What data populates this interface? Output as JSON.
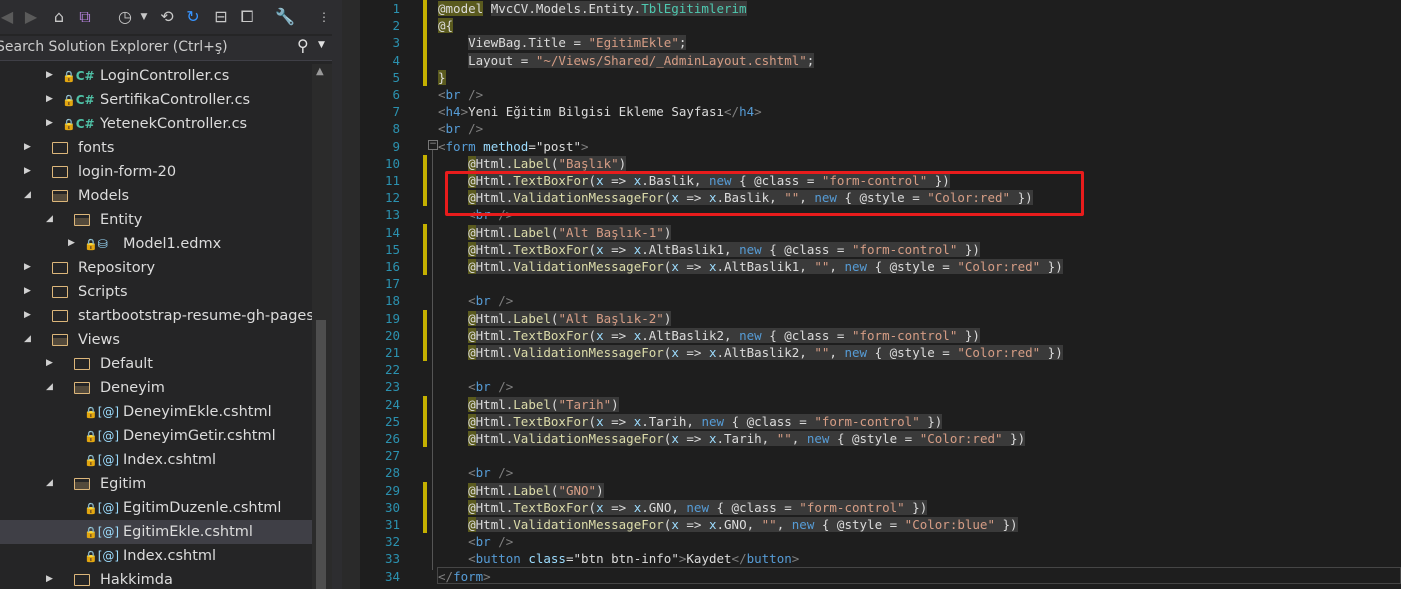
{
  "solution_explorer": {
    "search_placeholder": "Search Solution Explorer (Ctrl+ş)",
    "tree": [
      {
        "label": "LoginController.cs",
        "type": "cs",
        "level": 2,
        "expander": "collapsed"
      },
      {
        "label": "SertifikaController.cs",
        "type": "cs",
        "level": 2,
        "expander": "collapsed"
      },
      {
        "label": "YetenekController.cs",
        "type": "cs",
        "level": 2,
        "expander": "collapsed"
      },
      {
        "label": "fonts",
        "type": "folder",
        "level": 1,
        "expander": "collapsed"
      },
      {
        "label": "login-form-20",
        "type": "folder",
        "level": 1,
        "expander": "collapsed"
      },
      {
        "label": "Models",
        "type": "folder-open",
        "level": 1,
        "expander": "expanded"
      },
      {
        "label": "Entity",
        "type": "folder-open",
        "level": 2,
        "expander": "expanded"
      },
      {
        "label": "Model1.edmx",
        "type": "edmx",
        "level": 3,
        "expander": "collapsed"
      },
      {
        "label": "Repository",
        "type": "folder",
        "level": 1,
        "expander": "collapsed"
      },
      {
        "label": "Scripts",
        "type": "folder",
        "level": 1,
        "expander": "collapsed"
      },
      {
        "label": "startbootstrap-resume-gh-pages",
        "type": "folder",
        "level": 1,
        "expander": "collapsed"
      },
      {
        "label": "Views",
        "type": "folder-open",
        "level": 1,
        "expander": "expanded"
      },
      {
        "label": "Default",
        "type": "folder",
        "level": 2,
        "expander": "collapsed"
      },
      {
        "label": "Deneyim",
        "type": "folder-open",
        "level": 2,
        "expander": "expanded"
      },
      {
        "label": "DeneyimEkle.cshtml",
        "type": "razor",
        "level": 3,
        "expander": "none"
      },
      {
        "label": "DeneyimGetir.cshtml",
        "type": "razor",
        "level": 3,
        "expander": "none"
      },
      {
        "label": "Index.cshtml",
        "type": "razor",
        "level": 3,
        "expander": "none"
      },
      {
        "label": "Egitim",
        "type": "folder-open",
        "level": 2,
        "expander": "expanded"
      },
      {
        "label": "EgitimDuzenle.cshtml",
        "type": "razor",
        "level": 3,
        "expander": "none"
      },
      {
        "label": "EgitimEkle.cshtml",
        "type": "razor",
        "level": 3,
        "expander": "none",
        "selected": true
      },
      {
        "label": "Index.cshtml",
        "type": "razor",
        "level": 3,
        "expander": "none"
      },
      {
        "label": "Hakkimda",
        "type": "folder",
        "level": 2,
        "expander": "collapsed"
      }
    ]
  },
  "editor": {
    "lines": [
      {
        "n": "1",
        "changed": true,
        "html": "<span class=\"rz2\">@model</span> <span class=\"hl\">MvcCV.Models.Entity.<span class=\"ty\">TblEgitimlerim</span></span>"
      },
      {
        "n": "2",
        "changed": true,
        "html": "<span class=\"rz2\">@{</span>"
      },
      {
        "n": "3",
        "changed": true,
        "html": "    <span class=\"hl\">ViewBag.Title = <span class=\"s\">\"EgitimEkle\"</span>;</span>"
      },
      {
        "n": "4",
        "changed": true,
        "html": "    <span class=\"hl\">Layout = <span class=\"s\">\"~/Views/Shared/_AdminLayout.cshtml\"</span>;</span>"
      },
      {
        "n": "5",
        "changed": true,
        "html": "<span class=\"rz2\">}</span>"
      },
      {
        "n": "6",
        "changed": false,
        "html": "<span class=\"tg\">&lt;</span><span class=\"t\">br</span> <span class=\"tg\">/&gt;</span>"
      },
      {
        "n": "7",
        "changed": false,
        "html": "<span class=\"tg\">&lt;</span><span class=\"t\">h4</span><span class=\"tg\">&gt;</span>Yeni Eğitim Bilgisi Ekleme Sayfası<span class=\"tg\">&lt;/</span><span class=\"t\">h4</span><span class=\"tg\">&gt;</span>"
      },
      {
        "n": "8",
        "changed": false,
        "html": "<span class=\"tg\">&lt;</span><span class=\"t\">br</span> <span class=\"tg\">/&gt;</span>"
      },
      {
        "n": "9",
        "changed": false,
        "html": "<span class=\"tg\">&lt;</span><span class=\"t\">form</span> <span class=\"at\">method</span>=\"post\"<span class=\"tg\">&gt;</span>"
      },
      {
        "n": "10",
        "changed": true,
        "html": "    <span class=\"hl\"><span class=\"rz2\">@</span>Html.<span class=\"m\">Label</span>(<span class=\"s\">\"Başlık\"</span>)</span>"
      },
      {
        "n": "11",
        "changed": true,
        "html": "    <span class=\"hl\"><span class=\"rz2\">@</span>Html.<span class=\"m\">TextBoxFor</span>(<span class=\"at\">x</span> =&gt; <span class=\"at\">x</span>.Baslik, <span class=\"k\">new</span> { @class = <span class=\"s\">\"form-control\"</span> })</span>"
      },
      {
        "n": "12",
        "changed": true,
        "html": "    <span class=\"hl\"><span class=\"rz2\">@</span>Html.<span class=\"m\">ValidationMessageFor</span>(<span class=\"at\">x</span> =&gt; <span class=\"at\">x</span>.Baslik, <span class=\"s\">\"\"</span>, <span class=\"k\">new</span> { @style = <span class=\"s\">\"Color:red\"</span> })</span>"
      },
      {
        "n": "13",
        "changed": false,
        "html": "    <span class=\"tg\">&lt;</span><span class=\"t\">br</span> <span class=\"tg\">/&gt;</span>"
      },
      {
        "n": "14",
        "changed": true,
        "html": "    <span class=\"hl\"><span class=\"rz2\">@</span>Html.<span class=\"m\">Label</span>(<span class=\"s\">\"Alt Başlık-1\"</span>)</span>"
      },
      {
        "n": "15",
        "changed": true,
        "html": "    <span class=\"hl\"><span class=\"rz2\">@</span>Html.<span class=\"m\">TextBoxFor</span>(<span class=\"at\">x</span> =&gt; <span class=\"at\">x</span>.AltBaslik1, <span class=\"k\">new</span> { @class = <span class=\"s\">\"form-control\"</span> })</span>"
      },
      {
        "n": "16",
        "changed": true,
        "html": "    <span class=\"hl\"><span class=\"rz2\">@</span>Html.<span class=\"m\">ValidationMessageFor</span>(<span class=\"at\">x</span> =&gt; <span class=\"at\">x</span>.AltBaslik1, <span class=\"s\">\"\"</span>, <span class=\"k\">new</span> { @style = <span class=\"s\">\"Color:red\"</span> })</span>"
      },
      {
        "n": "17",
        "changed": false,
        "html": ""
      },
      {
        "n": "18",
        "changed": false,
        "html": "    <span class=\"tg\">&lt;</span><span class=\"t\">br</span> <span class=\"tg\">/&gt;</span>"
      },
      {
        "n": "19",
        "changed": true,
        "html": "    <span class=\"hl\"><span class=\"rz2\">@</span>Html.<span class=\"m\">Label</span>(<span class=\"s\">\"Alt Başlık-2\"</span>)</span>"
      },
      {
        "n": "20",
        "changed": true,
        "html": "    <span class=\"hl\"><span class=\"rz2\">@</span>Html.<span class=\"m\">TextBoxFor</span>(<span class=\"at\">x</span> =&gt; <span class=\"at\">x</span>.AltBaslik2, <span class=\"k\">new</span> { @class = <span class=\"s\">\"form-control\"</span> })</span>"
      },
      {
        "n": "21",
        "changed": true,
        "html": "    <span class=\"hl\"><span class=\"rz2\">@</span>Html.<span class=\"m\">ValidationMessageFor</span>(<span class=\"at\">x</span> =&gt; <span class=\"at\">x</span>.AltBaslik2, <span class=\"s\">\"\"</span>, <span class=\"k\">new</span> { @style = <span class=\"s\">\"Color:red\"</span> })</span>"
      },
      {
        "n": "22",
        "changed": false,
        "html": ""
      },
      {
        "n": "23",
        "changed": false,
        "html": "    <span class=\"tg\">&lt;</span><span class=\"t\">br</span> <span class=\"tg\">/&gt;</span>"
      },
      {
        "n": "24",
        "changed": true,
        "html": "    <span class=\"hl\"><span class=\"rz2\">@</span>Html.<span class=\"m\">Label</span>(<span class=\"s\">\"Tarih\"</span>)</span>"
      },
      {
        "n": "25",
        "changed": true,
        "html": "    <span class=\"hl\"><span class=\"rz2\">@</span>Html.<span class=\"m\">TextBoxFor</span>(<span class=\"at\">x</span> =&gt; <span class=\"at\">x</span>.Tarih, <span class=\"k\">new</span> { @class = <span class=\"s\">\"form-control\"</span> })</span>"
      },
      {
        "n": "26",
        "changed": true,
        "html": "    <span class=\"hl\"><span class=\"rz2\">@</span>Html.<span class=\"m\">ValidationMessageFor</span>(<span class=\"at\">x</span> =&gt; <span class=\"at\">x</span>.Tarih, <span class=\"s\">\"\"</span>, <span class=\"k\">new</span> { @style = <span class=\"s\">\"Color:red\"</span> })</span>"
      },
      {
        "n": "27",
        "changed": false,
        "html": ""
      },
      {
        "n": "28",
        "changed": false,
        "html": "    <span class=\"tg\">&lt;</span><span class=\"t\">br</span> <span class=\"tg\">/&gt;</span>"
      },
      {
        "n": "29",
        "changed": true,
        "html": "    <span class=\"hl\"><span class=\"rz2\">@</span>Html.<span class=\"m\">Label</span>(<span class=\"s\">\"GNO\"</span>)</span>"
      },
      {
        "n": "30",
        "changed": true,
        "html": "    <span class=\"hl\"><span class=\"rz2\">@</span>Html.<span class=\"m\">TextBoxFor</span>(<span class=\"at\">x</span> =&gt; <span class=\"at\">x</span>.GNO, <span class=\"k\">new</span> { @class = <span class=\"s\">\"form-control\"</span> })</span>"
      },
      {
        "n": "31",
        "changed": true,
        "html": "    <span class=\"hl\"><span class=\"rz2\">@</span>Html.<span class=\"m\">ValidationMessageFor</span>(<span class=\"at\">x</span> =&gt; <span class=\"at\">x</span>.GNO, <span class=\"s\">\"\"</span>, <span class=\"k\">new</span> { @style = <span class=\"s\">\"Color:blue\"</span> })</span>"
      },
      {
        "n": "32",
        "changed": false,
        "html": "    <span class=\"tg\">&lt;</span><span class=\"t\">br</span> <span class=\"tg\">/&gt;</span>"
      },
      {
        "n": "33",
        "changed": false,
        "html": "    <span class=\"tg\">&lt;</span><span class=\"t\">button</span> <span class=\"at\">class</span>=\"btn btn-info\"<span class=\"tg\">&gt;</span>Kaydet<span class=\"tg\">&lt;/</span><span class=\"t\">button</span><span class=\"tg\">&gt;</span>"
      },
      {
        "n": "34",
        "changed": false,
        "html": "<span class=\"tg\">&lt;/</span><span class=\"t\">form</span><span class=\"tg\">&gt;</span>"
      }
    ]
  },
  "colors": {
    "accent_highlight": "#e81c1c",
    "change_marker": "#c4b000"
  }
}
